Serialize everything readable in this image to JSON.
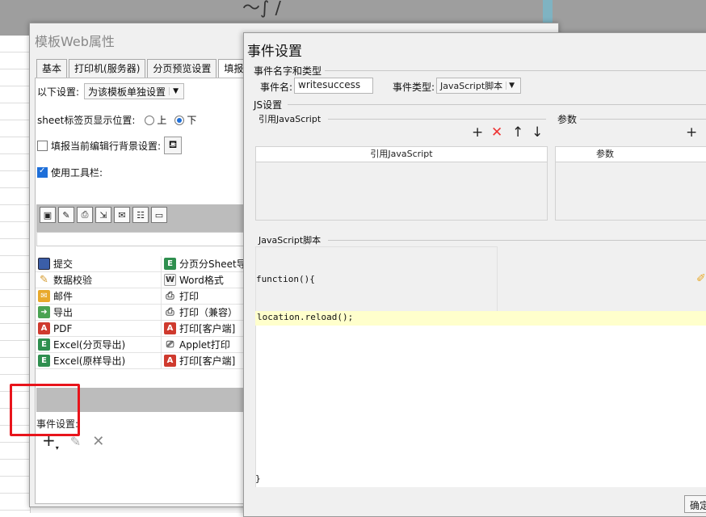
{
  "template_dialog": {
    "title": "模板Web属性",
    "tabs": [
      "基本",
      "打印机(服务器)",
      "分页预览设置",
      "填报"
    ],
    "setting_label": "以下设置:",
    "setting_value": "为该模板单独设置",
    "sheet_position_label": "sheet标签页显示位置:",
    "sheet_position_options": [
      "上",
      "下"
    ],
    "fill_bg_label": "填报当前编辑行背景设置:",
    "use_toolbar_label": "使用工具栏:",
    "buttons": [
      [
        "提交",
        "分页分Sheet导"
      ],
      [
        "数据校验",
        "Word格式"
      ],
      [
        "邮件",
        "打印"
      ],
      [
        "导出",
        "打印（兼容）"
      ],
      [
        "PDF",
        "打印[客户端]"
      ],
      [
        "Excel(分页导出)",
        "Applet打印"
      ],
      [
        "Excel(原样导出)",
        "打印[客户端]"
      ]
    ],
    "event_label": "事件设置:"
  },
  "event_dialog": {
    "title": "事件设置",
    "name_type_group": "事件名字和类型",
    "event_name_label": "事件名:",
    "event_name_value": "writesuccess",
    "event_type_label": "事件类型:",
    "event_type_value": "JavaScript脚本",
    "js_group": "JS设置",
    "ref_js_label": "引用JavaScript",
    "params_label": "参数",
    "ref_js_column": "引用JavaScript",
    "param_column": "参数",
    "script_label": "JavaScript脚本",
    "code_open": "function(){",
    "code_body": "location.reload();",
    "code_close": "}",
    "ok_button": "确定"
  }
}
